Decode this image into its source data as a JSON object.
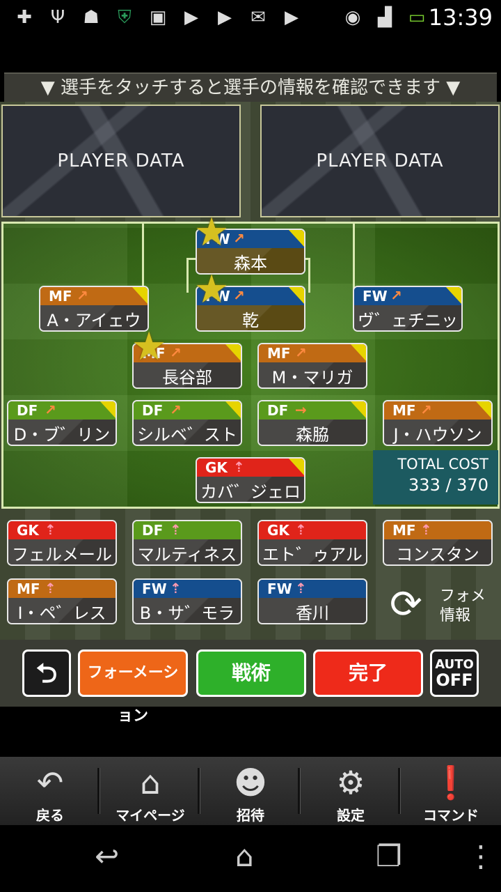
{
  "status_bar": {
    "time": "13:39",
    "icons": [
      "plus-icon",
      "usb-icon",
      "android-icon",
      "shield-icon",
      "chat-icon",
      "play-store-icon",
      "play-store-icon",
      "gmail-icon",
      "shop-icon",
      "wifi-icon",
      "signal-icon",
      "battery-icon"
    ]
  },
  "hint": "▼ 選手をタッチすると選手の情報を確認できます ▼",
  "player_data": {
    "left": "PLAYER DATA",
    "right": "PLAYER DATA"
  },
  "cost": {
    "label": "TOTAL COST",
    "value": "333 / 370"
  },
  "field_players": [
    {
      "pos": "FW",
      "arrow": "↗",
      "name": "森本",
      "star": true
    },
    {
      "pos": "MF",
      "arrow": "↗",
      "name": "A・アイェウ",
      "star": false
    },
    {
      "pos": "FW",
      "arrow": "↗",
      "name": "乾",
      "star": true
    },
    {
      "pos": "FW",
      "arrow": "↗",
      "name": "ヴ゛ェチニッチ",
      "star": false
    },
    {
      "pos": "MF",
      "arrow": "↗",
      "name": "長谷部",
      "star": true
    },
    {
      "pos": "MF",
      "arrow": "↗",
      "name": "M・マリガ",
      "star": false
    },
    {
      "pos": "DF",
      "arrow": "↗",
      "name": "D・ブ゛リント",
      "star": false
    },
    {
      "pos": "DF",
      "arrow": "↗",
      "name": "シルベ゛ストレ",
      "star": false
    },
    {
      "pos": "DF",
      "arrow": "→",
      "name": "森脇",
      "star": false
    },
    {
      "pos": "MF",
      "arrow": "↗",
      "name": "J・ハウソン",
      "star": false
    },
    {
      "pos": "GK",
      "arrow": "⇡",
      "name": "カバ゛ジェロ",
      "star": false
    }
  ],
  "bench_players": [
    {
      "pos": "GK",
      "arrow": "⇡",
      "name": "フェルメール"
    },
    {
      "pos": "DF",
      "arrow": "⇡",
      "name": "マルティネス"
    },
    {
      "pos": "GK",
      "arrow": "⇡",
      "name": "エト゛ゥアルト゛"
    },
    {
      "pos": "MF",
      "arrow": "⇡",
      "name": "コンスタン"
    },
    {
      "pos": "MF",
      "arrow": "⇡",
      "name": "I・ペ゛レス"
    },
    {
      "pos": "FW",
      "arrow": "⇡",
      "name": "B・サ゛モラ"
    },
    {
      "pos": "FW",
      "arrow": "⇡",
      "name": "香川"
    }
  ],
  "forme_info": {
    "line1": "フォメ",
    "line2": "情報"
  },
  "actions": {
    "back": "⮌",
    "formation": "フォーメーション",
    "tactics": "戦術",
    "done": "完了",
    "auto_line1": "AUTO",
    "auto_line2": "OFF"
  },
  "menu": [
    {
      "icon": "back-arrow-icon",
      "label": "戻る"
    },
    {
      "icon": "home-icon",
      "label": "マイページ"
    },
    {
      "icon": "people-icon",
      "label": "招待"
    },
    {
      "icon": "gear-icon",
      "label": "設定"
    },
    {
      "icon": "exclamation-icon",
      "label": "コマンド"
    }
  ],
  "colors": {
    "fw": "#154e8e",
    "mf": "#c06a14",
    "df": "#5a9a1c",
    "gk": "#e0241a",
    "cost_panel": "#1c5a60"
  }
}
